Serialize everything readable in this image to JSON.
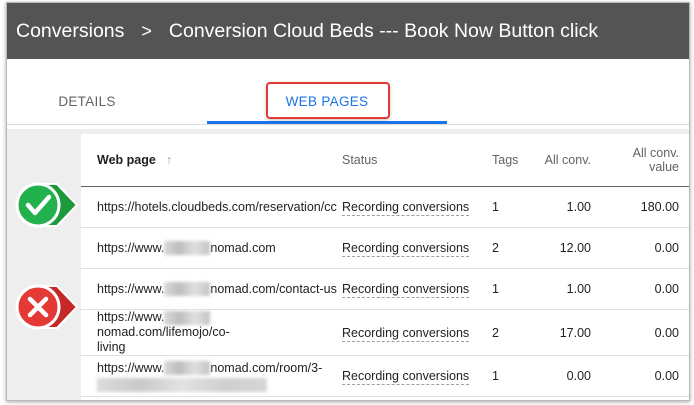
{
  "header": {
    "crumb": "Conversions",
    "separator": ">",
    "title": "Conversion Cloud Beds --- Book Now Button click"
  },
  "tabs": [
    {
      "label": "DETAILS",
      "active": false
    },
    {
      "label": "WEB PAGES",
      "active": true
    }
  ],
  "table": {
    "columns": {
      "webpage": "Web page",
      "sort_icon": "↑",
      "status": "Status",
      "tags": "Tags",
      "all_conv": "All conv.",
      "all_conv_value": "All conv. value"
    },
    "rows": [
      {
        "url_a": "https://hotels.cloudbeds.com/reservation/cc",
        "url_b": "",
        "status": "Recording conversions",
        "tags": "1",
        "all_conv": "1.00",
        "all_conv_value": "180.00"
      },
      {
        "url_a": "https://www.",
        "url_b": "nomad.com",
        "status": "Recording conversions",
        "tags": "2",
        "all_conv": "12.00",
        "all_conv_value": "0.00"
      },
      {
        "url_a": "https://www.",
        "url_b": "nomad.com/contact-us",
        "status": "Recording conversions",
        "tags": "1",
        "all_conv": "1.00",
        "all_conv_value": "0.00"
      },
      {
        "url_a": "https://www.",
        "url_b": "nomad.com/lifemojo/co-",
        "url_c": "living",
        "status": "Recording conversions",
        "tags": "2",
        "all_conv": "17.00",
        "all_conv_value": "0.00"
      },
      {
        "url_a": "https://www.",
        "url_b": "nomad.com/room/3-",
        "status": "Recording conversions",
        "tags": "1",
        "all_conv": "0.00",
        "all_conv_value": "0.00"
      }
    ]
  },
  "markers": {
    "check_color": "#22b14c",
    "cross_color": "#e53935",
    "check_icon": "checkmark-icon",
    "cross_icon": "x-icon"
  },
  "colors": {
    "header_bg": "#545454",
    "accent": "#1a73e8",
    "highlight": "#e53935"
  }
}
